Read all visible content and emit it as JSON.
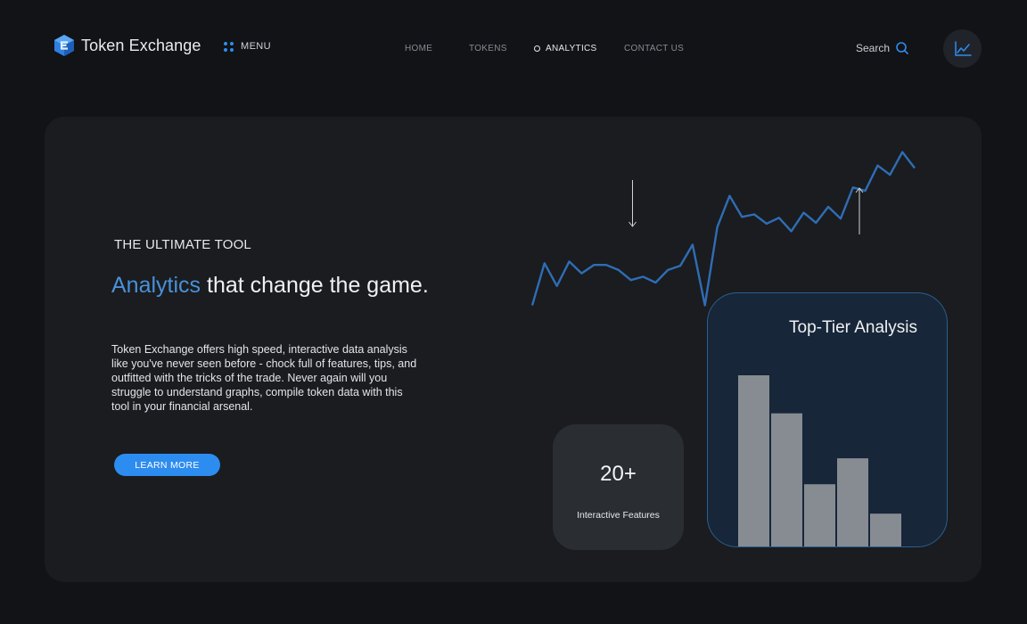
{
  "brand": {
    "name": "Token Exchange",
    "logo_icon": "token-exchange-logo-icon",
    "accent_color": "#2f8cf0"
  },
  "menu": {
    "label": "MENU",
    "icon": "grid-dots-icon"
  },
  "nav": {
    "items": [
      {
        "label": "HOME",
        "active": false
      },
      {
        "label": "TOKENS",
        "active": false
      },
      {
        "label": "ANALYTICS",
        "active": true
      },
      {
        "label": "CONTACT US",
        "active": false
      }
    ]
  },
  "search": {
    "label": "Search",
    "icon": "search-icon"
  },
  "header_action": {
    "icon": "line-chart-icon"
  },
  "hero": {
    "eyebrow": "THE ULTIMATE TOOL",
    "headline_accent": "Analytics",
    "headline_rest": " that change the game.",
    "description": "Token Exchange offers high speed, interactive data analysis like you've never seen before - chock full of features, tips, and outfitted with the tricks of the trade. Never again will you struggle to understand graphs, compile token data with this tool in your financial arsenal.",
    "cta_label": "LEARN MORE"
  },
  "features": {
    "count": "20+",
    "label": "Interactive Features"
  },
  "analysis": {
    "title": "Top-Tier Analysis"
  },
  "chart_data": [
    {
      "type": "line",
      "color": "#2f6db5",
      "annotations": [
        "arrow-down",
        "arrow-up"
      ],
      "values": [
        10,
        60,
        33,
        62,
        48,
        58,
        58,
        52,
        40,
        44,
        37,
        52,
        57,
        82,
        10,
        103,
        140,
        115,
        118,
        107,
        114,
        98,
        120,
        108,
        127,
        113,
        150,
        146,
        176,
        165,
        192,
        173
      ]
    },
    {
      "type": "bar",
      "color": "#878c93",
      "values": [
        100,
        78,
        37,
        52,
        20
      ]
    }
  ]
}
